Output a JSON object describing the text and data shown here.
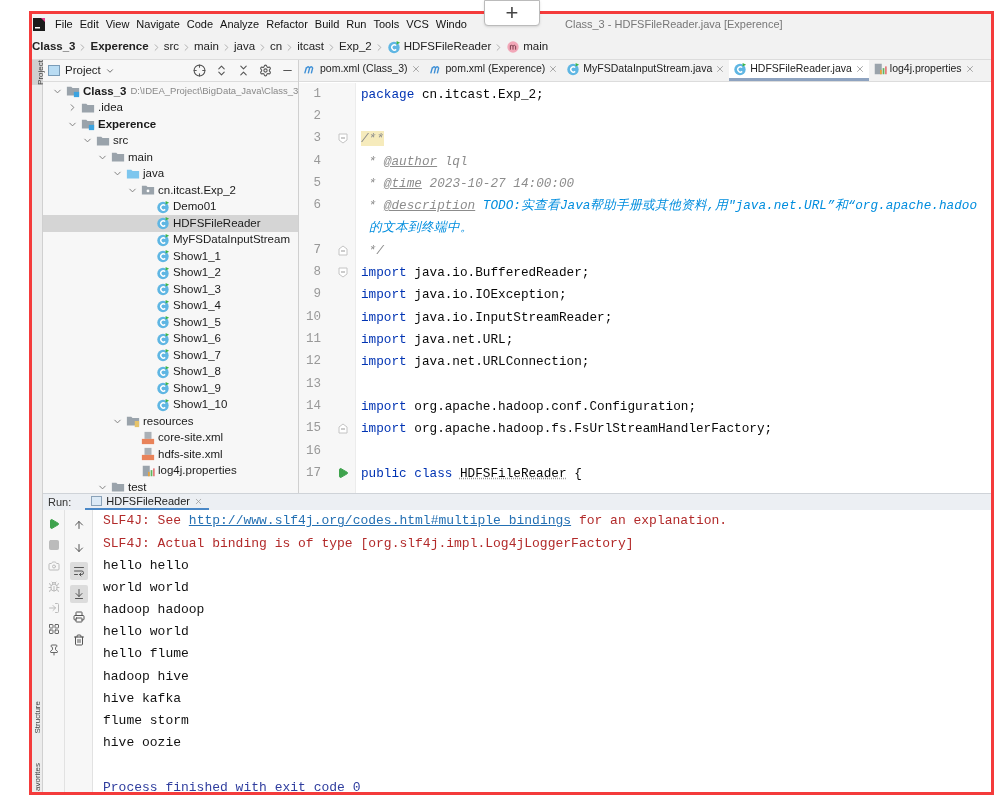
{
  "window": {
    "title": "Class_3 - HDFSFileReader.java [Experence]"
  },
  "overlay_button": {
    "label": "+"
  },
  "menu": [
    "File",
    "Edit",
    "View",
    "Navigate",
    "Code",
    "Analyze",
    "Refactor",
    "Build",
    "Run",
    "Tools",
    "VCS",
    "Windo"
  ],
  "breadcrumb": [
    {
      "label": "Class_3",
      "kind": "module"
    },
    {
      "label": "Experence",
      "kind": "module"
    },
    {
      "label": "src",
      "kind": "folder"
    },
    {
      "label": "main",
      "kind": "folder"
    },
    {
      "label": "java",
      "kind": "folder"
    },
    {
      "label": "cn",
      "kind": "folder"
    },
    {
      "label": "itcast",
      "kind": "folder"
    },
    {
      "label": "Exp_2",
      "kind": "folder"
    },
    {
      "label": "HDFSFileReader",
      "kind": "class"
    },
    {
      "label": "main",
      "kind": "method"
    }
  ],
  "side_tabs_top": [
    {
      "label": "Project",
      "selected": true
    }
  ],
  "side_tabs_bottom": [
    {
      "label": "Structure",
      "selected": false
    },
    {
      "label": "avorites",
      "selected": false
    }
  ],
  "project_panel": {
    "title": "Project",
    "tree": [
      {
        "label": "Class_3",
        "path": "D:\\IDEA_Project\\BigData_Java\\Class_3",
        "kind": "module",
        "expanded": true,
        "selected": false,
        "children": [
          {
            "label": ".idea",
            "kind": "folder",
            "expanded": false,
            "selected": false
          },
          {
            "label": "Experence",
            "kind": "module",
            "expanded": true,
            "selected": false,
            "children": [
              {
                "label": "src",
                "kind": "folder",
                "expanded": true,
                "selected": false,
                "children": [
                  {
                    "label": "main",
                    "kind": "folder",
                    "expanded": true,
                    "selected": false,
                    "children": [
                      {
                        "label": "java",
                        "kind": "source_folder",
                        "expanded": true,
                        "selected": false,
                        "children": [
                          {
                            "label": "cn.itcast.Exp_2",
                            "kind": "package",
                            "expanded": true,
                            "selected": false,
                            "children": [
                              {
                                "label": "Demo01",
                                "kind": "class",
                                "selected": false
                              },
                              {
                                "label": "HDFSFileReader",
                                "kind": "class",
                                "selected": true
                              },
                              {
                                "label": "MyFSDataInputStream",
                                "kind": "class",
                                "selected": false
                              },
                              {
                                "label": "Show1_1",
                                "kind": "class",
                                "selected": false
                              },
                              {
                                "label": "Show1_2",
                                "kind": "class",
                                "selected": false
                              },
                              {
                                "label": "Show1_3",
                                "kind": "class",
                                "selected": false
                              },
                              {
                                "label": "Show1_4",
                                "kind": "class",
                                "selected": false
                              },
                              {
                                "label": "Show1_5",
                                "kind": "class",
                                "selected": false
                              },
                              {
                                "label": "Show1_6",
                                "kind": "class",
                                "selected": false
                              },
                              {
                                "label": "Show1_7",
                                "kind": "class",
                                "selected": false
                              },
                              {
                                "label": "Show1_8",
                                "kind": "class",
                                "selected": false
                              },
                              {
                                "label": "Show1_9",
                                "kind": "class",
                                "selected": false
                              },
                              {
                                "label": "Show1_10",
                                "kind": "class",
                                "selected": false
                              }
                            ]
                          }
                        ]
                      },
                      {
                        "label": "resources",
                        "kind": "resources_folder",
                        "expanded": true,
                        "selected": false,
                        "children": [
                          {
                            "label": "core-site.xml",
                            "kind": "xml",
                            "selected": false
                          },
                          {
                            "label": "hdfs-site.xml",
                            "kind": "xml",
                            "selected": false
                          },
                          {
                            "label": "log4j.properties",
                            "kind": "properties",
                            "selected": false
                          }
                        ]
                      }
                    ]
                  },
                  {
                    "label": "test",
                    "kind": "folder",
                    "expanded": true,
                    "selected": false
                  }
                ]
              }
            ]
          }
        ]
      }
    ]
  },
  "editor_tabs": [
    {
      "label": "pom.xml (Class_3)",
      "kind": "maven",
      "selected": false
    },
    {
      "label": "pom.xml (Experence)",
      "kind": "maven",
      "selected": false
    },
    {
      "label": "MyFSDataInputStream.java",
      "kind": "class",
      "selected": false
    },
    {
      "label": "HDFSFileReader.java",
      "kind": "class",
      "selected": true
    },
    {
      "label": "log4j.properties",
      "kind": "properties",
      "selected": false
    }
  ],
  "code_lines": [
    {
      "number": "1",
      "fold_start": false,
      "fold_end": false,
      "runnable": false,
      "tokens": [
        {
          "text": "package",
          "kind": "keyword"
        },
        {
          "text": " cn.itcast.Exp_2;",
          "kind": "plain"
        }
      ]
    },
    {
      "number": "2",
      "fold_start": false,
      "fold_end": false,
      "runnable": false
    },
    {
      "number": "3",
      "fold_start": true,
      "fold_end": false,
      "runnable": false,
      "tokens": [
        {
          "text": "/**",
          "kind": "matched_comment"
        }
      ]
    },
    {
      "number": "4",
      "fold_start": false,
      "fold_end": false,
      "runnable": false,
      "tokens": [
        {
          "text": " * ",
          "kind": "comment"
        },
        {
          "text": "@author",
          "kind": "doc_tag"
        },
        {
          "text": " lql",
          "kind": "comment"
        }
      ]
    },
    {
      "number": "5",
      "fold_start": false,
      "fold_end": false,
      "runnable": false,
      "tokens": [
        {
          "text": " * ",
          "kind": "comment"
        },
        {
          "text": "@time",
          "kind": "doc_tag"
        },
        {
          "text": " 2023-10-27 14:00:00",
          "kind": "comment"
        }
      ]
    },
    {
      "number": "6",
      "fold_start": false,
      "fold_end": false,
      "runnable": false,
      "tokens": [
        {
          "text": " * ",
          "kind": "comment"
        },
        {
          "text": "@description",
          "kind": "doc_tag"
        },
        {
          "text": " TODO:实查看Java帮助手册或其他资料,用\"java.net.URL”和“org.apache.hadoo",
          "kind": "todo"
        }
      ]
    },
    {
      "fold_start": false,
      "fold_end": false,
      "runnable": false,
      "tokens": [
        {
          "text": " 的文本到终端中。",
          "kind": "todo"
        }
      ]
    },
    {
      "number": "7",
      "fold_start": false,
      "fold_end": true,
      "runnable": false,
      "tokens": [
        {
          "text": " */",
          "kind": "comment"
        }
      ]
    },
    {
      "number": "8",
      "fold_start": true,
      "fold_end": false,
      "runnable": false,
      "tokens": [
        {
          "text": "import",
          "kind": "keyword"
        },
        {
          "text": " java.io.BufferedReader;",
          "kind": "plain"
        }
      ]
    },
    {
      "number": "9",
      "fold_start": false,
      "fold_end": false,
      "runnable": false,
      "tokens": [
        {
          "text": "import",
          "kind": "keyword"
        },
        {
          "text": " java.io.IOException;",
          "kind": "plain"
        }
      ]
    },
    {
      "number": "10",
      "fold_start": false,
      "fold_end": false,
      "runnable": false,
      "tokens": [
        {
          "text": "import",
          "kind": "keyword"
        },
        {
          "text": " java.io.InputStreamReader;",
          "kind": "plain"
        }
      ]
    },
    {
      "number": "11",
      "fold_start": false,
      "fold_end": false,
      "runnable": false,
      "tokens": [
        {
          "text": "import",
          "kind": "keyword"
        },
        {
          "text": " java.net.URL;",
          "kind": "plain"
        }
      ]
    },
    {
      "number": "12",
      "fold_start": false,
      "fold_end": false,
      "runnable": false,
      "tokens": [
        {
          "text": "import",
          "kind": "keyword"
        },
        {
          "text": " java.net.URLConnection;",
          "kind": "plain"
        }
      ]
    },
    {
      "number": "13",
      "fold_start": false,
      "fold_end": false,
      "runnable": false
    },
    {
      "number": "14",
      "fold_start": false,
      "fold_end": false,
      "runnable": false,
      "tokens": [
        {
          "text": "import",
          "kind": "keyword"
        },
        {
          "text": " org.apache.hadoop.conf.Configuration;",
          "kind": "plain"
        }
      ]
    },
    {
      "number": "15",
      "fold_start": false,
      "fold_end": true,
      "runnable": false,
      "tokens": [
        {
          "text": "import",
          "kind": "keyword"
        },
        {
          "text": " org.apache.hadoop.fs.FsUrlStreamHandlerFactory;",
          "kind": "plain"
        }
      ]
    },
    {
      "number": "16",
      "fold_start": false,
      "fold_end": false,
      "runnable": false
    },
    {
      "number": "17",
      "fold_start": false,
      "fold_end": false,
      "runnable": true,
      "tokens": [
        {
          "text": "public class ",
          "kind": "keyword"
        },
        {
          "text": "HDFSFileReader",
          "kind": "unused_name"
        },
        {
          "text": " {",
          "kind": "plain"
        }
      ]
    }
  ],
  "run_panel": {
    "label": "Run:",
    "tab": {
      "label": "HDFSFileReader",
      "selected": true
    },
    "left_tools": [
      {
        "kind": "run",
        "disabled": false
      },
      {
        "kind": "stop",
        "disabled": true
      },
      {
        "kind": "camera",
        "disabled": true
      },
      {
        "kind": "debug",
        "disabled": true
      },
      {
        "kind": "exit",
        "disabled": true
      },
      {
        "kind": "layout",
        "disabled": false
      },
      {
        "kind": "pin",
        "disabled": false
      }
    ],
    "right_tools": [
      {
        "kind": "up",
        "on": false
      },
      {
        "kind": "down",
        "on": false
      },
      {
        "kind": "soft_wrap",
        "on": true
      },
      {
        "kind": "scroll_end",
        "on": true
      },
      {
        "kind": "print",
        "on": false
      },
      {
        "kind": "clear",
        "on": false
      }
    ],
    "console": [
      {
        "kind": "error",
        "segments": [
          {
            "text": "SLF4J: See ",
            "kind": "text"
          },
          {
            "text": "http://www.slf4j.org/codes.html#multiple_bindings",
            "kind": "link"
          },
          {
            "text": " for an explanation.",
            "kind": "text"
          }
        ]
      },
      {
        "kind": "error",
        "segments": [
          {
            "text": "SLF4J: Actual binding is of type [org.slf4j.impl.Log4jLoggerFactory]",
            "kind": "text"
          }
        ]
      },
      {
        "kind": "output",
        "segments": [
          {
            "text": "hello hello",
            "kind": "text"
          }
        ]
      },
      {
        "kind": "output",
        "segments": [
          {
            "text": "world world",
            "kind": "text"
          }
        ]
      },
      {
        "kind": "output",
        "segments": [
          {
            "text": "hadoop hadoop",
            "kind": "text"
          }
        ]
      },
      {
        "kind": "output",
        "segments": [
          {
            "text": "hello world",
            "kind": "text"
          }
        ]
      },
      {
        "kind": "output",
        "segments": [
          {
            "text": "hello flume",
            "kind": "text"
          }
        ]
      },
      {
        "kind": "output",
        "segments": [
          {
            "text": "hadoop hive",
            "kind": "text"
          }
        ]
      },
      {
        "kind": "output",
        "segments": [
          {
            "text": "hive kafka",
            "kind": "text"
          }
        ]
      },
      {
        "kind": "output",
        "segments": [
          {
            "text": "flume storm",
            "kind": "text"
          }
        ]
      },
      {
        "kind": "output",
        "segments": [
          {
            "text": "hive oozie",
            "kind": "text"
          }
        ]
      },
      {
        "kind": "blank"
      },
      {
        "kind": "system",
        "segments": [
          {
            "text": "Process finished with exit code 0",
            "kind": "text"
          }
        ]
      }
    ]
  }
}
